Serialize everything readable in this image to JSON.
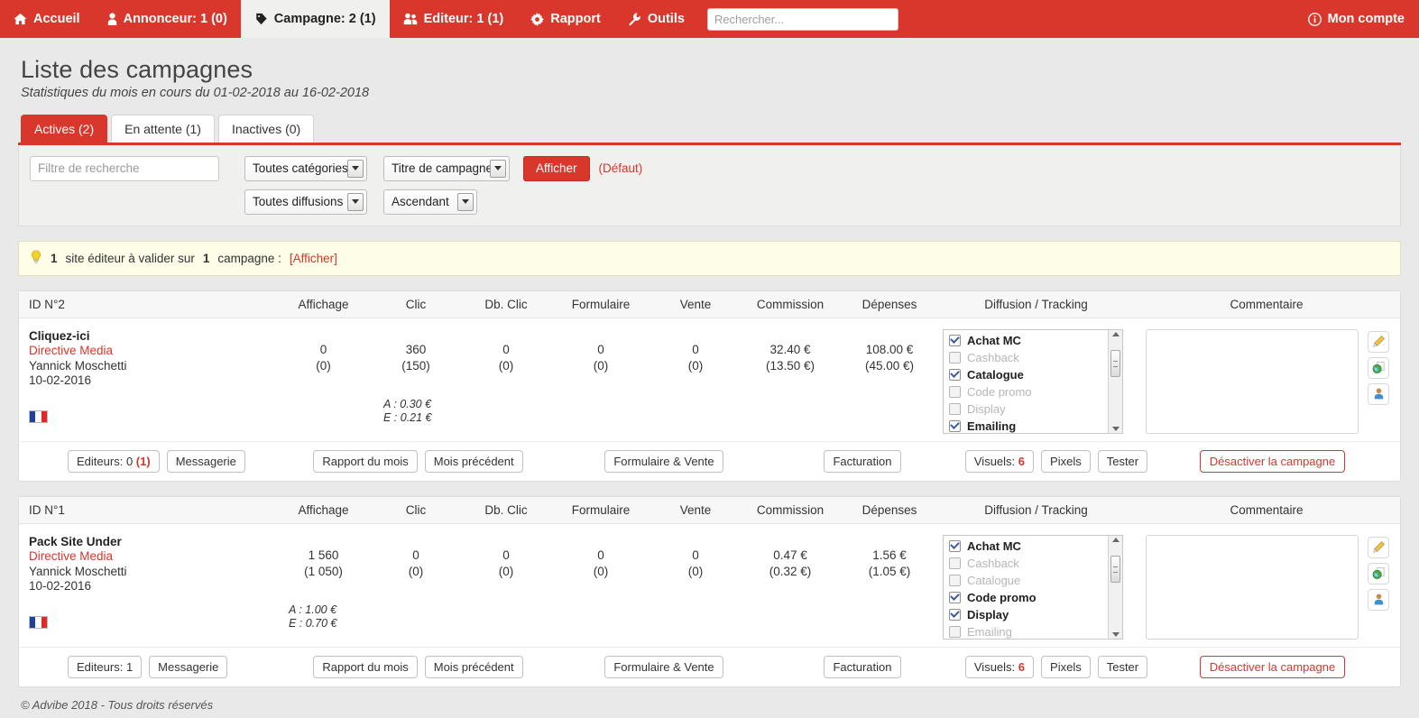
{
  "topnav": {
    "items": [
      {
        "icon": "home-icon",
        "label": "Accueil",
        "active": false
      },
      {
        "icon": "user-icon",
        "label": "Annonceur: 1 (0)",
        "active": false
      },
      {
        "icon": "tag-icon",
        "label": "Campagne: 2 (1)",
        "active": true
      },
      {
        "icon": "users-icon",
        "label": "Editeur: 1 (1)",
        "active": false
      },
      {
        "icon": "gear-icon",
        "label": "Rapport",
        "active": false
      },
      {
        "icon": "wrench-icon",
        "label": "Outils",
        "active": false
      }
    ],
    "search": {
      "value": "",
      "placeholder": "Rechercher..."
    },
    "account": {
      "icon": "info-icon",
      "label": "Mon compte"
    },
    "brand_color": "#d9362c"
  },
  "header": {
    "title": "Liste des campagnes",
    "subtitle": "Statistiques du mois en cours du 01-02-2018 au 16-02-2018"
  },
  "tabs": [
    {
      "label": "Actives (2)",
      "active": true
    },
    {
      "label": "En attente (1)",
      "active": false
    },
    {
      "label": "Inactives (0)",
      "active": false
    }
  ],
  "filters": {
    "search": {
      "value": "",
      "placeholder": "Filtre de recherche"
    },
    "category": {
      "value": "Toutes catégories"
    },
    "diffusion": {
      "value": "Toutes diffusions"
    },
    "sort_field": {
      "value": "Titre de campagne"
    },
    "sort_order": {
      "value": "Ascendant"
    },
    "submit_label": "Afficher",
    "default_link": "(Défaut)"
  },
  "notice": {
    "icon": "lightbulb-icon",
    "count1": "1",
    "text1": "site éditeur à valider sur",
    "count2": "1",
    "text2": "campagne :",
    "link": "[Afficher]"
  },
  "columns": {
    "id": "ID N°",
    "affichage": "Affichage",
    "clic": "Clic",
    "db_clic": "Db. Clic",
    "formulaire": "Formulaire",
    "vente": "Vente",
    "commission": "Commission",
    "depenses": "Dépenses",
    "diffusion": "Diffusion / Tracking",
    "commentaire": "Commentaire"
  },
  "actions": {
    "editeurs_label": "Editeurs:",
    "messagerie": "Messagerie",
    "rapport_du_mois": "Rapport du mois",
    "mois_precedent": "Mois précédent",
    "formulaire_vente": "Formulaire & Vente",
    "facturation": "Facturation",
    "visuels_label": "Visuels:",
    "pixels": "Pixels",
    "tester": "Tester",
    "desactiver": "Désactiver la campagne"
  },
  "campaigns": [
    {
      "id_header": "ID N°2",
      "title": "Cliquez-ici",
      "advertiser": "Directive Media",
      "contact": "Yannick Moschetti",
      "date": "10-02-2016",
      "country_flag": "fr-flag-icon",
      "affichage": {
        "main": "0",
        "sub": "(0)"
      },
      "clic": {
        "main": "360",
        "sub": "(150)"
      },
      "db_clic": {
        "main": "0",
        "sub": "(0)"
      },
      "formulaire": {
        "main": "0",
        "sub": "(0)"
      },
      "vente": {
        "main": "0",
        "sub": "(0)"
      },
      "commission": {
        "main": "32.40 €",
        "sub": "(13.50 €)"
      },
      "depenses": {
        "main": "108.00 €",
        "sub": "(45.00 €)"
      },
      "price_a": "A : 0.30 €",
      "price_e": "E : 0.21 €",
      "diffusions": [
        {
          "label": "Achat MC",
          "checked": true
        },
        {
          "label": "Cashback",
          "checked": false
        },
        {
          "label": "Catalogue",
          "checked": true
        },
        {
          "label": "Code promo",
          "checked": false
        },
        {
          "label": "Display",
          "checked": false
        },
        {
          "label": "Emailing",
          "checked": true
        }
      ],
      "comment": "",
      "side_icons": [
        "pencil-icon",
        "globe-page-icon",
        "person-icon"
      ],
      "editeurs_count": "0",
      "editeurs_pending": "(1)",
      "visuels_count": "6"
    },
    {
      "id_header": "ID N°1",
      "title": "Pack Site Under",
      "advertiser": "Directive Media",
      "contact": "Yannick Moschetti",
      "date": "10-02-2016",
      "country_flag": "fr-flag-icon",
      "affichage": {
        "main": "1 560",
        "sub": "(1 050)"
      },
      "clic": {
        "main": "0",
        "sub": "(0)"
      },
      "db_clic": {
        "main": "0",
        "sub": "(0)"
      },
      "formulaire": {
        "main": "0",
        "sub": "(0)"
      },
      "vente": {
        "main": "0",
        "sub": "(0)"
      },
      "commission": {
        "main": "0.47 €",
        "sub": "(0.32 €)"
      },
      "depenses": {
        "main": "1.56 €",
        "sub": "(1.05 €)"
      },
      "price_a": "A : 1.00 €",
      "price_e": "E : 0.70 €",
      "diffusions": [
        {
          "label": "Achat MC",
          "checked": true
        },
        {
          "label": "Cashback",
          "checked": false
        },
        {
          "label": "Catalogue",
          "checked": false
        },
        {
          "label": "Code promo",
          "checked": true
        },
        {
          "label": "Display",
          "checked": true
        },
        {
          "label": "Emailing",
          "checked": false
        }
      ],
      "comment": "",
      "side_icons": [
        "pencil-icon",
        "globe-page-icon",
        "person-icon"
      ],
      "editeurs_count": "1",
      "editeurs_pending": "",
      "visuels_count": "6"
    }
  ],
  "footer": {
    "text": "© Advibe 2018 - Tous droits réservés"
  }
}
